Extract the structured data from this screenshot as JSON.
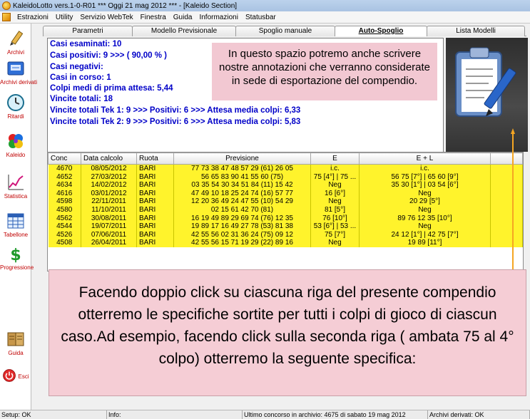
{
  "window": {
    "title": "KaleidoLotto vers.1-0-R01  ***  Oggi 21 mag 2012  ***  - [Kaleido Section]"
  },
  "menu": {
    "items": [
      "Estrazioni",
      "Utility",
      "Servizio WebTek",
      "Finestra",
      "Guida",
      "Informazioni",
      "Statusbar"
    ]
  },
  "sidebar": {
    "items": [
      {
        "label": "Archivi",
        "icon": "pencil-icon"
      },
      {
        "label": "Archivi derivati",
        "icon": "archive-box-icon"
      },
      {
        "label": "Ritardi",
        "icon": "clock-icon"
      },
      {
        "label": "Kaleido",
        "icon": "kaleido-flower-icon"
      },
      {
        "label": "Statistica",
        "icon": "trend-chart-icon"
      },
      {
        "label": "Tabellone",
        "icon": "grid-table-icon"
      },
      {
        "label": "Progressione",
        "icon": "dollar-icon"
      },
      {
        "label": "Guida",
        "icon": "book-icon"
      },
      {
        "label": "Esci",
        "icon": "exit-icon"
      }
    ]
  },
  "tabs": [
    {
      "label": "Parametri",
      "active": false
    },
    {
      "label": "Modello Previsionale",
      "active": false
    },
    {
      "label": "Spoglio manuale",
      "active": false
    },
    {
      "label": "Auto-Spoglio",
      "active": true
    },
    {
      "label": "Lista Modelli",
      "active": false
    }
  ],
  "summary": {
    "lines": [
      "Casi esaminati: 10",
      "Casi positivi: 9 >>> ( 90,00 % )",
      "Casi negativi:",
      "Casi in corso: 1",
      "Colpi medi di prima attesa: 5,44",
      "Vincite totali: 18",
      "Vincite totali Tek 1: 9 >>> Positivi: 6 >>> Attesa media colpi: 6,33",
      "Vincite totali Tek 2: 9 >>> Positivi: 6 >>> Attesa media colpi: 5,83"
    ],
    "note": "In questo spazio potremo anche scrivere nostre annotazioni che verranno considerate in sede di esportazione del compendio."
  },
  "table": {
    "headers": [
      "Conc",
      "Data calcolo",
      "Ruota",
      "Previsione",
      "E",
      "E + L"
    ],
    "rows": [
      [
        "4670",
        "08/05/2012",
        "BARI",
        "77 73 38 47 48 57 29 (61) 26 05",
        "i.c.",
        "i.c."
      ],
      [
        "4652",
        "27/03/2012",
        "BARI",
        "56 65 83 90 41 55 60 (75)",
        "75 [4°] | 75 ...",
        "56 75 [7°] | 65 60 [9°]"
      ],
      [
        "4634",
        "14/02/2012",
        "BARI",
        "03 35 54 30 34 51 84 (11) 15 42",
        "Neg",
        "35 30 [1°] | 03 54 [6°]"
      ],
      [
        "4616",
        "03/01/2012",
        "BARI",
        "47 49 10 18 25 24 74 (16) 57 77",
        "16 [6°]",
        "Neg"
      ],
      [
        "4598",
        "22/11/2011",
        "BARI",
        "12 20 36 49 24 47 55 (10) 54 29",
        "Neg",
        "20 29 [5°]"
      ],
      [
        "4580",
        "11/10/2011",
        "BARI",
        "02 15 61 42 70 (81)",
        "81 [5°]",
        "Neg"
      ],
      [
        "4562",
        "30/08/2011",
        "BARI",
        "16 19 49 89 29 69 74 (76) 12 35",
        "76 [10°]",
        "89 76 12 35 [10°]"
      ],
      [
        "4544",
        "19/07/2011",
        "BARI",
        "19 89 17 16 49 27 78 (53) 81 38",
        "53 [6°] | 53 ...",
        "Neg"
      ],
      [
        "4526",
        "07/06/2011",
        "BARI",
        "42 55 56 02 31 36 24 (75) 09 12",
        "75 [7°]",
        "24 12 [1°] | 42 75 [7°]"
      ],
      [
        "4508",
        "26/04/2011",
        "BARI",
        "42 55 56 15 71 19 29 (22) 89 16",
        "Neg",
        "19 89 [11°]"
      ]
    ]
  },
  "big_note": "Facendo doppio click su ciascuna riga del presente compendio otterremo le specifiche sortite per tutti i colpi di gioco di ciascun caso.Ad esempio, facendo click sulla seconda riga ( ambata 75 al 4° colpo) otterremo la seguente specifica:",
  "statusbar": {
    "setup": "Setup: OK",
    "info": "Info:",
    "last_draw": "Ultimo concorso in archivio: 4675 di sabato 19 mag 2012",
    "derived": "Archivi derivati: OK"
  },
  "colors": {
    "summary_text": "#0000c8",
    "row_yellow": "#fff32c",
    "note_pink": "#f2c8d2",
    "arrow_orange": "#f5a623"
  }
}
